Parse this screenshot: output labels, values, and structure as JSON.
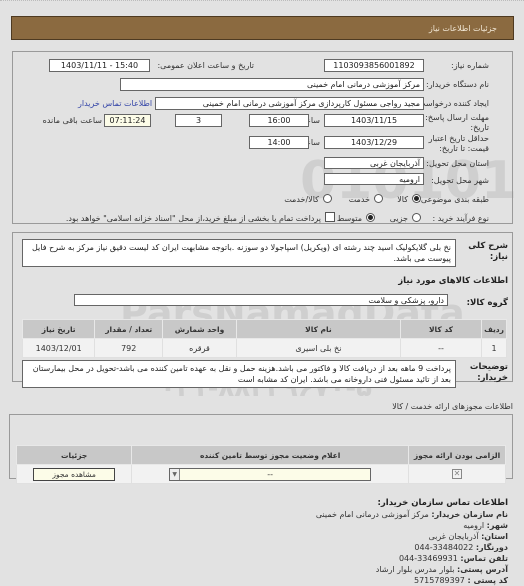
{
  "header": {
    "title": "جزئیات اطلاعات نیاز"
  },
  "form": {
    "need_number": {
      "label": "شماره نیاز:",
      "value": "1103093856001892"
    },
    "announce_datetime": {
      "label": "تاریخ و ساعت اعلان عمومی:",
      "value": "1403/11/11 - 15:40"
    },
    "buyer_org": {
      "label": "نام دستگاه خریدار:",
      "value": "مرکز آموزشی درمانی امام خمینی"
    },
    "requester": {
      "label": "ایجاد کننده درخواست:",
      "value": "مجید  رواجی مسئول کارپردازی مرکز آموزشی درمانی امام خمینی"
    },
    "buyer_contact_link": "اطلاعات تماس خریدار",
    "reply_deadline": {
      "label_line1": "مهلت ارسال پاسخ: تا",
      "label_line2": "تاریخ:",
      "date": "1403/11/15",
      "time_label": "ساعت",
      "time": "16:00",
      "days": "3",
      "days_label": "روز و",
      "remaining": "07:11:24",
      "remaining_label": "ساعت باقی مانده"
    },
    "price_validity": {
      "label_line1": "حداقل تاریخ اعتبار",
      "label_line2": "قیمت: تا تاریخ:",
      "date": "1403/12/29",
      "time_label": "ساعت",
      "time": "14:00"
    },
    "province": {
      "label": "استان محل تحویل:",
      "value": "آذربایجان غربی"
    },
    "city": {
      "label": "شهر محل تحویل:",
      "value": "ارومیه"
    },
    "category": {
      "label": "طبقه بندی موضوعی:",
      "options": [
        "کالا",
        "خدمت",
        "کالا/خدمت"
      ],
      "selected": "کالا"
    },
    "purchase_process": {
      "label": "نوع فرآیند خرید :",
      "options": [
        "جزیی",
        "متوسط"
      ],
      "selected": "متوسط",
      "treasury_checkbox_label": "پرداخت تمام یا بخشی از مبلغ خرید،از محل \"اسناد خزانه اسلامی\" خواهد بود.",
      "treasury_checked": false
    }
  },
  "description": {
    "label_line1": "شرح کلی",
    "label_line2": "نیاز:",
    "text": "نخ بلی گلایکولیک اسید چند رشته ای (ویکریل) اسپاجولا دو سوزنه .باتوجه مشابهت ایران کد لیست دقیق نیاز مرکز به شرح فایل پیوست می باشد."
  },
  "goods": {
    "section_title": "اطلاعات کالاهای مورد نیاز",
    "group_label": "گروه کالا:",
    "group_value": "دارو، پزشکی و سلامت",
    "columns": [
      "ردیف",
      "کد کالا",
      "نام کالا",
      "واحد شمارش",
      "تعداد / مقدار",
      "تاریخ نیاز"
    ],
    "rows": [
      {
        "row": "1",
        "code": "--",
        "name": "نخ بلی اسیری",
        "unit": "قرقره",
        "qty": "792",
        "date": "1403/12/01"
      }
    ]
  },
  "buyer_notes": {
    "label_line1": "توضیحات",
    "label_line2": "خریدار:",
    "text": "پرداخت 9 ماهه بعد از دریافت کالا و فاکتور می باشد.هزینه حمل و نقل به عهده تامین کننده می باشد-تحویل در محل بیمارستان بعد از تائید مسئول فنی داروخانه می باشد. ایران کد مشابه است"
  },
  "permits": {
    "section_title": "اطلاعات مجوزهای ارائه خدمت / کالا",
    "columns": [
      "الزامی بودن ارائه مجوز",
      "اعلام وضعیت مجوز توسط تامین کننده",
      "جزئیات"
    ],
    "row": {
      "required_checked": true,
      "status_value": "--",
      "details_button": "مشاهده مجوز"
    }
  },
  "contact": {
    "title": "اطلاعات تماس سازمان خریدار:",
    "items": [
      {
        "label": "نام سازمان خریدار:",
        "value": "مرکز آموزشی درمانی امام خمینی"
      },
      {
        "label": "شهر:",
        "value": "ارومیه"
      },
      {
        "label": "استان:",
        "value": "آذربایجان غربی"
      },
      {
        "label": "دورنگار:",
        "value": "044-33484022"
      },
      {
        "label": "تلفن تماس:",
        "value": "044-33469931"
      },
      {
        "label": "آدرس پستی:",
        "value": "بلوار مدرس بلوار ارشاد"
      },
      {
        "label": "کد پستی :",
        "value": "5715789397"
      }
    ]
  },
  "watermark": {
    "brand": "ParsNamadData",
    "numbers": "010101",
    "phone": "۰۲۱-۸۸۳۴۹۶۷۰-۵"
  }
}
